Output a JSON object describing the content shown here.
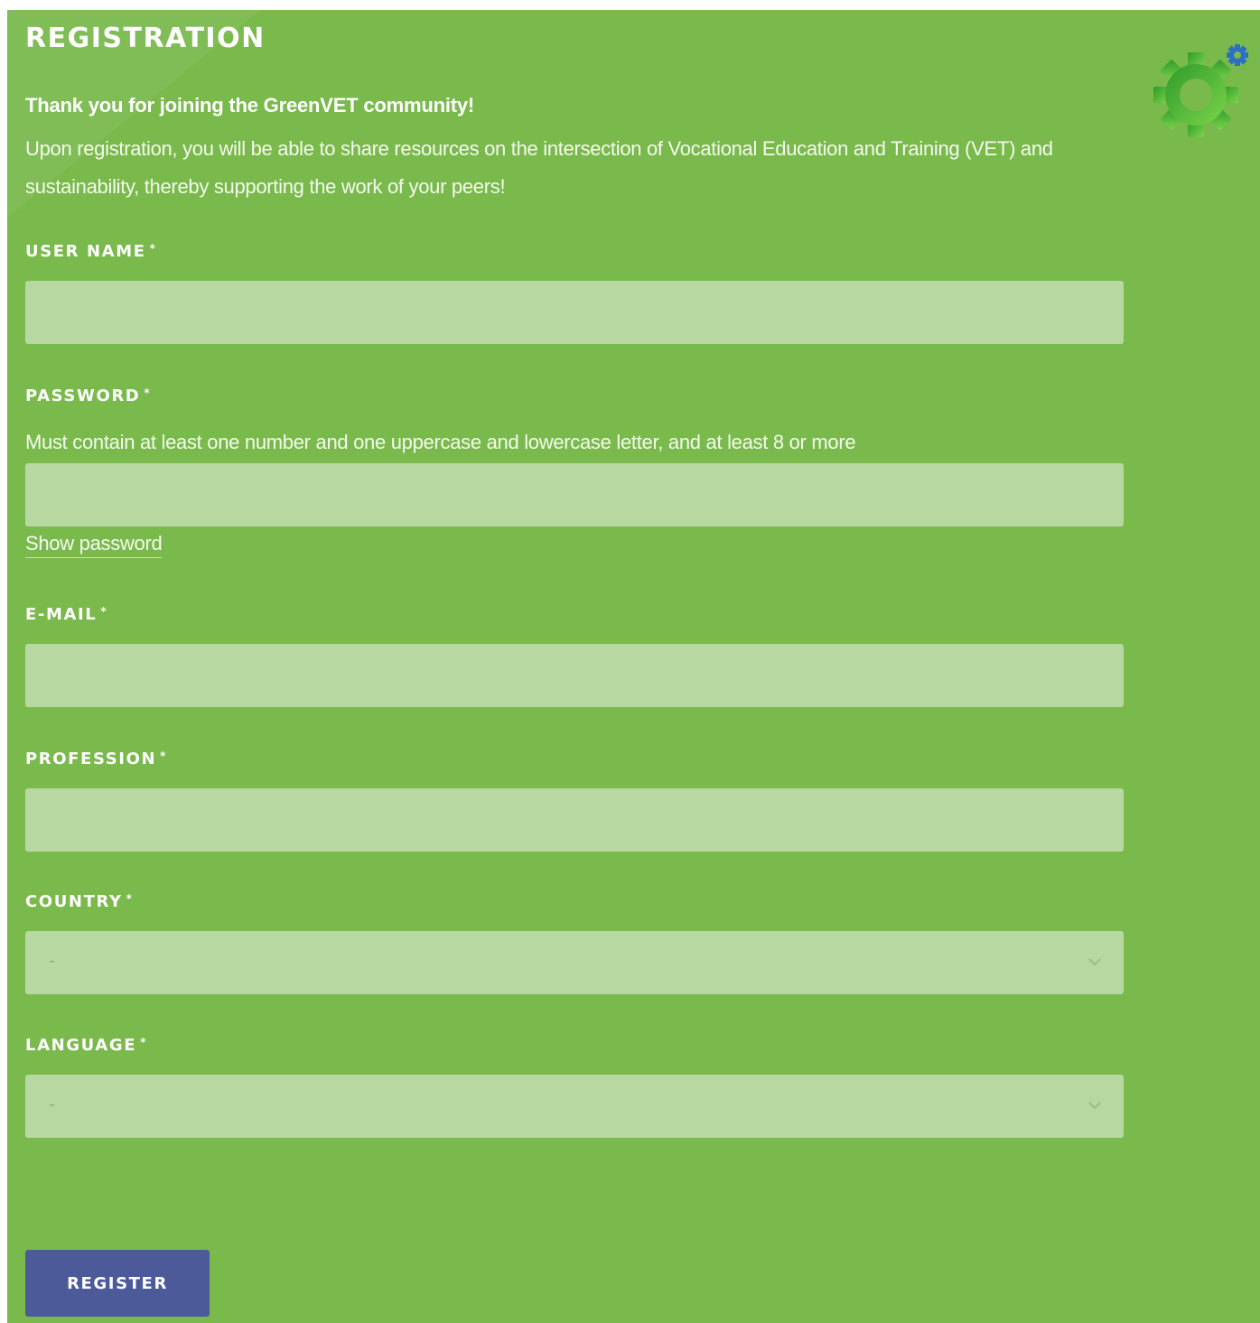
{
  "form": {
    "title": "REGISTRATION",
    "intro_heading": "Thank you for joining the GreenVET community!",
    "intro_text": "Upon registration, you will be able to share resources on the intersection of Vocational Education and Training (VET) and sustainability, thereby supporting the work of your peers!",
    "required_marker": "*",
    "fields": {
      "username": {
        "label": "USER NAME",
        "value": ""
      },
      "password": {
        "label": "PASSWORD",
        "hint": "Must contain at least one number and one uppercase and lowercase letter, and at least 8 or more",
        "value": "",
        "show_password_label": "Show password"
      },
      "email": {
        "label": "E-MAIL",
        "value": ""
      },
      "profession": {
        "label": "PROFESSION",
        "value": ""
      },
      "country": {
        "label": "COUNTRY",
        "selected": "-"
      },
      "language": {
        "label": "LANGUAGE",
        "selected": "-"
      }
    },
    "submit_label": "REGISTER"
  },
  "icons": {
    "logo": "gear-logo-icon",
    "country_chevron": "chevron-down-icon",
    "language_chevron": "chevron-down-icon"
  },
  "colors": {
    "background": "#7ab94c",
    "field_background": "#b8d8a1",
    "button": "#4d5a9a",
    "logo_green": "#3ea52c",
    "logo_blue": "#2d6fc4"
  }
}
